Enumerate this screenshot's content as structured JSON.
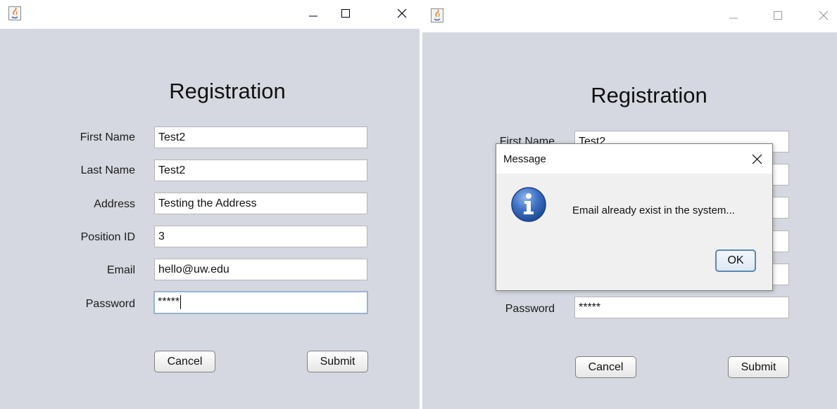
{
  "left_window": {
    "title": "Registration",
    "fields": [
      {
        "label": "First Name",
        "value": "Test2"
      },
      {
        "label": "Last Name",
        "value": "Test2"
      },
      {
        "label": "Address",
        "value": "Testing the Address"
      },
      {
        "label": "Position ID",
        "value": "3"
      },
      {
        "label": "Email",
        "value": "hello@uw.edu"
      },
      {
        "label": "Password",
        "value": "*****"
      }
    ],
    "cancel_label": "Cancel",
    "submit_label": "Submit"
  },
  "right_window": {
    "title": "Registration",
    "fields": [
      {
        "label": "First Name",
        "value": "Test2"
      },
      {
        "label": "Password",
        "value": "*****"
      }
    ],
    "cancel_label": "Cancel",
    "submit_label": "Submit"
  },
  "dialog": {
    "title": "Message",
    "message": "Email already exist in the system...",
    "ok_label": "OK",
    "icon": "info-icon"
  },
  "icons": {
    "app": "java-icon",
    "minimize": "minimize-icon",
    "maximize": "maximize-icon",
    "close": "close-icon"
  },
  "colors": {
    "form_background": "#d5d8e0",
    "focus_border": "#97b4cf",
    "info_blue": "#2f5fae"
  }
}
